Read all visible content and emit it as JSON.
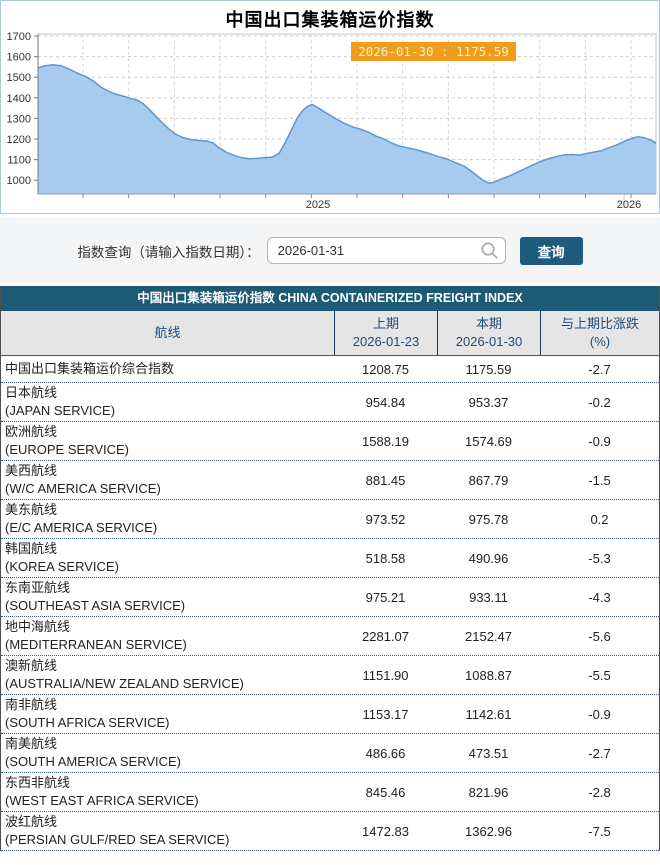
{
  "page": {
    "title": "中国出口集装箱运价指数"
  },
  "chart_data": {
    "type": "area",
    "title": "中国出口集装箱运价指数",
    "tooltip": "2026-01-30 : 1175.59",
    "highlight": {
      "date": "2026-01-30",
      "value": 1175.59
    },
    "ylim": [
      933,
      1710
    ],
    "yticks": [
      1000,
      1100,
      1200,
      1300,
      1400,
      1500,
      1600,
      1700
    ],
    "x_axis_labels": [
      "2025",
      "2026"
    ],
    "grid": "dashed",
    "area_fill": "#a6cbee",
    "line_color": "#5f96cf",
    "tooltip_bg": "#f09d1e",
    "points": [
      [
        37,
        1545
      ],
      [
        44,
        1556
      ],
      [
        52,
        1561
      ],
      [
        60,
        1556
      ],
      [
        68,
        1540
      ],
      [
        76,
        1521
      ],
      [
        84,
        1505
      ],
      [
        92,
        1483
      ],
      [
        100,
        1452
      ],
      [
        108,
        1431
      ],
      [
        116,
        1416
      ],
      [
        124,
        1406
      ],
      [
        130,
        1396
      ],
      [
        136,
        1390
      ],
      [
        142,
        1372
      ],
      [
        148,
        1345
      ],
      [
        154,
        1315
      ],
      [
        161,
        1280
      ],
      [
        168,
        1248
      ],
      [
        175,
        1222
      ],
      [
        182,
        1207
      ],
      [
        190,
        1197
      ],
      [
        198,
        1193
      ],
      [
        206,
        1190
      ],
      [
        212,
        1180
      ],
      [
        218,
        1158
      ],
      [
        226,
        1134
      ],
      [
        234,
        1119
      ],
      [
        241,
        1109
      ],
      [
        248,
        1104
      ],
      [
        256,
        1106
      ],
      [
        264,
        1110
      ],
      [
        271,
        1112
      ],
      [
        278,
        1130
      ],
      [
        284,
        1180
      ],
      [
        290,
        1240
      ],
      [
        296,
        1300
      ],
      [
        302,
        1340
      ],
      [
        307,
        1360
      ],
      [
        311,
        1368
      ],
      [
        317,
        1352
      ],
      [
        323,
        1333
      ],
      [
        330,
        1313
      ],
      [
        337,
        1292
      ],
      [
        344,
        1275
      ],
      [
        352,
        1258
      ],
      [
        360,
        1247
      ],
      [
        368,
        1232
      ],
      [
        376,
        1212
      ],
      [
        382,
        1202
      ],
      [
        390,
        1182
      ],
      [
        398,
        1166
      ],
      [
        406,
        1158
      ],
      [
        414,
        1150
      ],
      [
        422,
        1139
      ],
      [
        430,
        1127
      ],
      [
        438,
        1113
      ],
      [
        446,
        1103
      ],
      [
        452,
        1090
      ],
      [
        458,
        1078
      ],
      [
        464,
        1066
      ],
      [
        470,
        1044
      ],
      [
        476,
        1022
      ],
      [
        482,
        1000
      ],
      [
        488,
        986
      ],
      [
        493,
        990
      ],
      [
        500,
        1005
      ],
      [
        508,
        1020
      ],
      [
        516,
        1038
      ],
      [
        524,
        1056
      ],
      [
        532,
        1075
      ],
      [
        540,
        1092
      ],
      [
        548,
        1105
      ],
      [
        556,
        1116
      ],
      [
        564,
        1123
      ],
      [
        572,
        1125
      ],
      [
        578,
        1122
      ],
      [
        584,
        1128
      ],
      [
        592,
        1136
      ],
      [
        600,
        1143
      ],
      [
        608,
        1158
      ],
      [
        616,
        1172
      ],
      [
        624,
        1190
      ],
      [
        631,
        1203
      ],
      [
        637,
        1211
      ],
      [
        643,
        1207
      ],
      [
        649,
        1196
      ],
      [
        654,
        1183
      ],
      [
        657,
        1176
      ]
    ]
  },
  "query": {
    "label": "指数查询（请输入指数日期）：",
    "input_value": "2026-01-31",
    "button_label": "查询"
  },
  "table": {
    "title": "中国出口集装箱运价指数 CHINA CONTAINERIZED FREIGHT INDEX",
    "columns": {
      "route": "航线",
      "prev": "上期",
      "prev_date": "2026-01-23",
      "curr": "本期",
      "curr_date": "2026-01-30",
      "change_line1": "与上期比涨跌",
      "change_line2": "(%)"
    },
    "rows": [
      {
        "name_cn": "中国出口集装箱运价综合指数",
        "name_en": "",
        "prev": "1208.75",
        "curr": "1175.59",
        "change": "-2.7"
      },
      {
        "name_cn": "日本航线",
        "name_en": "(JAPAN SERVICE)",
        "prev": "954.84",
        "curr": "953.37",
        "change": "-0.2"
      },
      {
        "name_cn": "欧洲航线",
        "name_en": "(EUROPE SERVICE)",
        "prev": "1588.19",
        "curr": "1574.69",
        "change": "-0.9"
      },
      {
        "name_cn": "美西航线",
        "name_en": "(W/C AMERICA SERVICE)",
        "prev": "881.45",
        "curr": "867.79",
        "change": "-1.5"
      },
      {
        "name_cn": "美东航线",
        "name_en": "(E/C AMERICA SERVICE)",
        "prev": "973.52",
        "curr": "975.78",
        "change": "0.2"
      },
      {
        "name_cn": "韩国航线",
        "name_en": "(KOREA SERVICE)",
        "prev": "518.58",
        "curr": "490.96",
        "change": "-5.3"
      },
      {
        "name_cn": "东南亚航线",
        "name_en": "(SOUTHEAST ASIA SERVICE)",
        "prev": "975.21",
        "curr": "933.11",
        "change": "-4.3"
      },
      {
        "name_cn": "地中海航线",
        "name_en": "(MEDITERRANEAN SERVICE)",
        "prev": "2281.07",
        "curr": "2152.47",
        "change": "-5.6"
      },
      {
        "name_cn": "澳新航线",
        "name_en": "(AUSTRALIA/NEW ZEALAND SERVICE)",
        "prev": "1151.90",
        "curr": "1088.87",
        "change": "-5.5"
      },
      {
        "name_cn": "南非航线",
        "name_en": "(SOUTH AFRICA SERVICE)",
        "prev": "1153.17",
        "curr": "1142.61",
        "change": "-0.9"
      },
      {
        "name_cn": "南美航线",
        "name_en": "(SOUTH AMERICA SERVICE)",
        "prev": "486.66",
        "curr": "473.51",
        "change": "-2.7"
      },
      {
        "name_cn": "东西非航线",
        "name_en": "(WEST EAST AFRICA SERVICE)",
        "prev": "845.46",
        "curr": "821.96",
        "change": "-2.8"
      },
      {
        "name_cn": "波红航线",
        "name_en": "(PERSIAN GULF/RED SEA SERVICE)",
        "prev": "1472.83",
        "curr": "1362.96",
        "change": "-7.5"
      }
    ]
  },
  "colors": {
    "banner_teal": "#1c5a76",
    "button_teal": "#1d5c7d",
    "header_text_navy": "#1f4e79",
    "row_divider_navy": "#35568e",
    "tooltip_orange": "#f09d1e",
    "area_fill_blue": "#a6cbee",
    "panel_border_blue": "#aac9e3"
  }
}
